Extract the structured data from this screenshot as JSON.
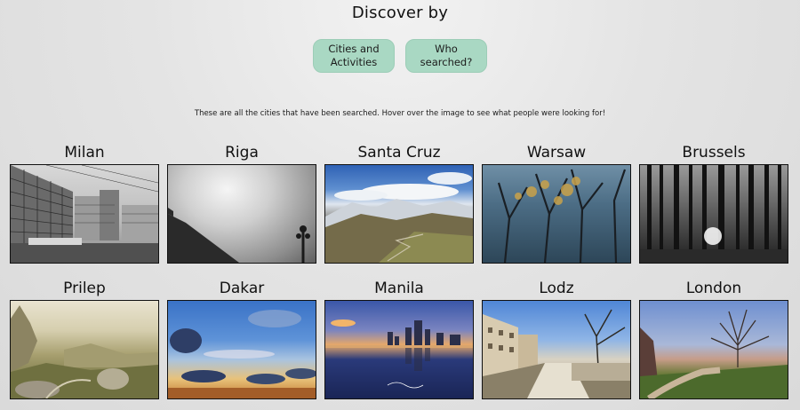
{
  "header": {
    "title": "Discover by"
  },
  "buttons": [
    {
      "label": "Cities and\nActivities"
    },
    {
      "label": "Who\nsearched?"
    }
  ],
  "intro": {
    "text": "These are all the cities that have been searched. Hover over the image to see what people were looking for!"
  },
  "cities": [
    {
      "name": "Milan",
      "image": "milan-office-buildings-bw"
    },
    {
      "name": "Riga",
      "image": "riga-cloudy-sky-bw"
    },
    {
      "name": "Santa Cruz",
      "image": "santa-cruz-mountains"
    },
    {
      "name": "Warsaw",
      "image": "warsaw-autumn-trees"
    },
    {
      "name": "Brussels",
      "image": "brussels-forest-bw"
    },
    {
      "name": "Prilep",
      "image": "prilep-rocky-hills"
    },
    {
      "name": "Dakar",
      "image": "dakar-sunset-clouds"
    },
    {
      "name": "Manila",
      "image": "manila-skyline-bay"
    },
    {
      "name": "Lodz",
      "image": "lodz-street-trees"
    },
    {
      "name": "London",
      "image": "london-tree-path"
    }
  ],
  "colors": {
    "button_bg": "#a9d8c3",
    "page_bg": "#e4e4e4",
    "border": "#111111"
  }
}
